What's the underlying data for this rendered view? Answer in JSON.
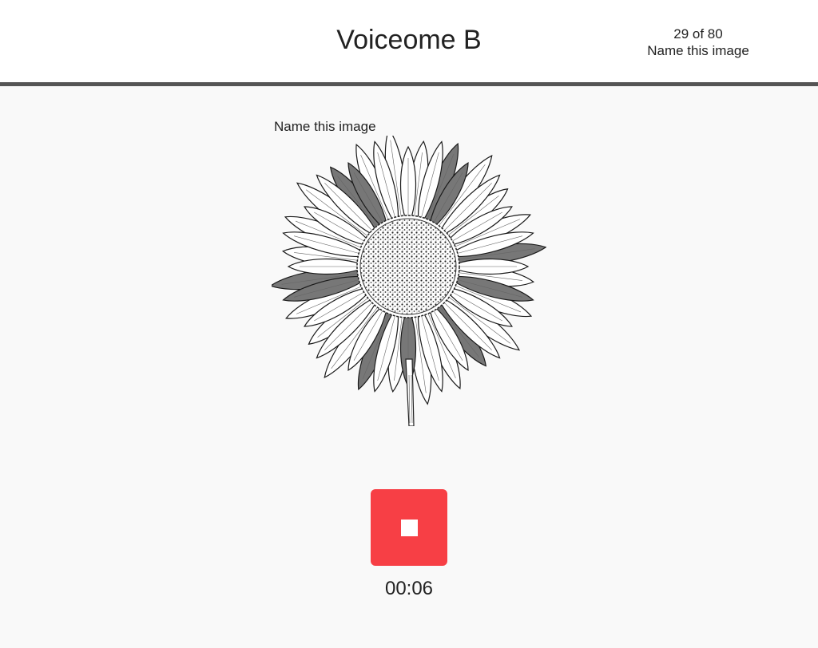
{
  "header": {
    "title": "Voiceome B",
    "progress": "29 of 80",
    "task_name": "Name this image"
  },
  "task": {
    "prompt": "Name this image",
    "image_icon": "sunflower-drawing-icon"
  },
  "recorder": {
    "button_icon": "stop-icon",
    "button_color": "#f73f45",
    "elapsed": "00:06"
  }
}
